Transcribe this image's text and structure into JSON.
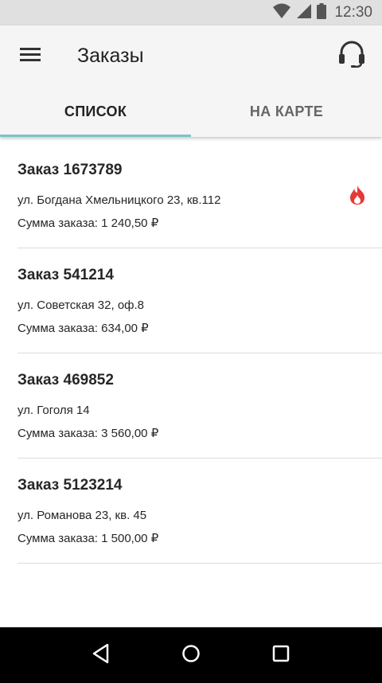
{
  "status_bar": {
    "time": "12:30",
    "icons": [
      "wifi-icon",
      "signal-icon",
      "battery-icon"
    ]
  },
  "header": {
    "title": "Заказы",
    "menu_icon": "menu-icon",
    "support_icon": "headset-icon"
  },
  "tabs": [
    {
      "label": "СПИСОК",
      "active": true
    },
    {
      "label": "НА КАРТЕ",
      "active": false
    }
  ],
  "orders": [
    {
      "title": "Заказ 1673789",
      "address": "ул. Богдана Хмельницкого 23, кв.112",
      "sum": "Сумма заказа: 1 240,50 ₽",
      "urgent": true
    },
    {
      "title": "Заказ 541214",
      "address": "ул. Советская 32, оф.8",
      "sum": "Сумма заказа: 634,00 ₽",
      "urgent": false
    },
    {
      "title": "Заказ 469852",
      "address": "ул. Гоголя 14",
      "sum": "Сумма заказа: 3 560,00 ₽",
      "urgent": false
    },
    {
      "title": "Заказ 5123214",
      "address": "ул. Романова 23, кв. 45",
      "sum": "Сумма заказа: 1 500,00 ₽",
      "urgent": false
    }
  ],
  "colors": {
    "tab_indicator": "#7bc4c4",
    "urgent": "#e53935",
    "nav_bar": "#000000"
  },
  "nav_bar": {
    "buttons": [
      "back-icon",
      "home-icon",
      "recents-icon"
    ]
  }
}
